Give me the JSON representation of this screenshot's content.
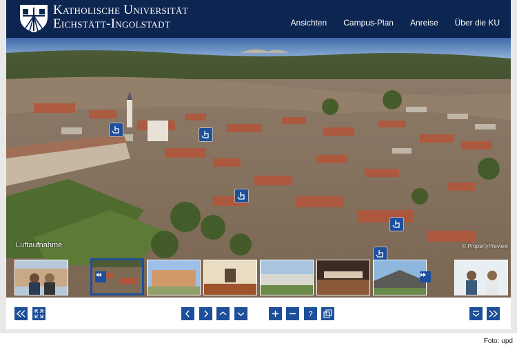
{
  "header": {
    "title_line1": "Katholische Universität",
    "title_line2": "Eichstätt-Ingolstadt",
    "nav": [
      "Ansichten",
      "Campus-Plan",
      "Anreise",
      "Über die KU"
    ]
  },
  "panorama": {
    "label": "Luftaufnahme",
    "credit": "© PropertyPreview"
  },
  "toolbar": {
    "left": [
      "rewind-icon",
      "fullscreen-icon"
    ],
    "center_nav": [
      "arrow-left-icon",
      "arrow-right-icon",
      "arrow-up-icon",
      "arrow-down-icon"
    ],
    "center_zoom": [
      "plus-icon",
      "minus-icon",
      "help-icon",
      "windows-icon"
    ],
    "right": [
      "menu-down-icon",
      "fast-forward-icon"
    ]
  },
  "colors": {
    "brand": "#0d2551",
    "button": "#1e4f9a"
  },
  "photo_credit": "Foto: upd"
}
